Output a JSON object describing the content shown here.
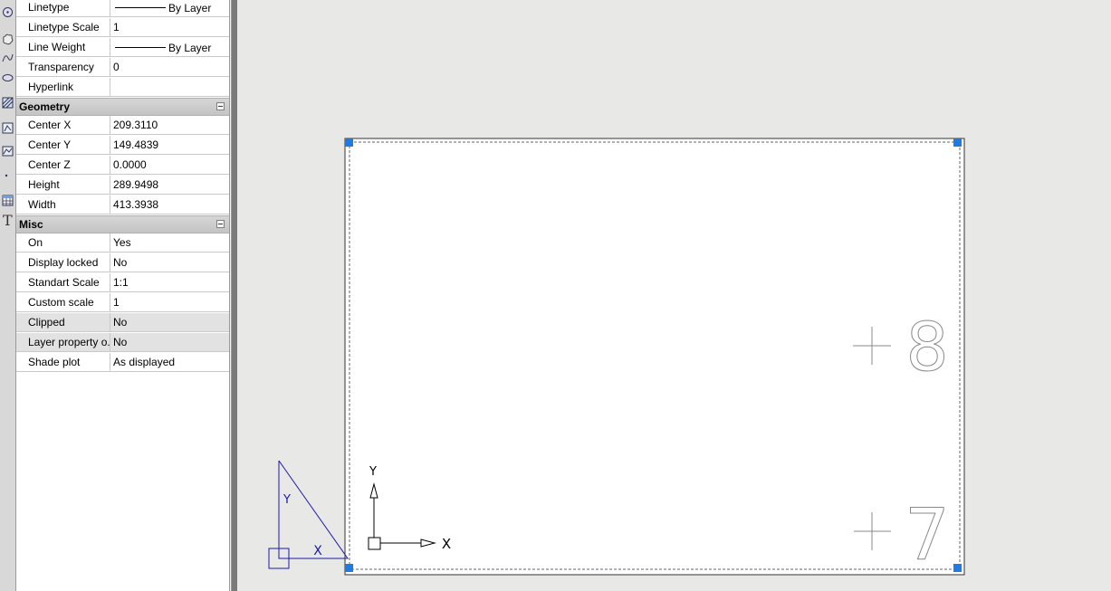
{
  "properties": {
    "general_rows": [
      {
        "name": "Linetype",
        "value": "By Layer",
        "line": true
      },
      {
        "name": "Linetype Scale",
        "value": "1"
      },
      {
        "name": "Line Weight",
        "value": "By Layer",
        "line": true
      },
      {
        "name": "Transparency",
        "value": "0"
      },
      {
        "name": "Hyperlink",
        "value": ""
      }
    ],
    "geometry": {
      "title": "Geometry",
      "rows": [
        {
          "name": "Center X",
          "value": "209.3110"
        },
        {
          "name": "Center Y",
          "value": "149.4839"
        },
        {
          "name": "Center Z",
          "value": "0.0000"
        },
        {
          "name": "Height",
          "value": "289.9498"
        },
        {
          "name": "Width",
          "value": "413.3938"
        }
      ]
    },
    "misc": {
      "title": "Misc",
      "rows": [
        {
          "name": "On",
          "value": "Yes"
        },
        {
          "name": "Display locked",
          "value": "No"
        },
        {
          "name": "Standart Scale",
          "value": "1:1"
        },
        {
          "name": "Custom scale",
          "value": "1"
        },
        {
          "name": "Clipped",
          "value": "No",
          "greyed": true
        },
        {
          "name": "Layer property o...",
          "value": "No",
          "greyed": true
        },
        {
          "name": "Shade plot",
          "value": "As displayed"
        }
      ]
    }
  },
  "viewport": {
    "grid_labels": [
      "8",
      "7"
    ],
    "ucs_labels": {
      "x": "X",
      "y": "Y"
    },
    "paper_ucs_labels": {
      "x": "X",
      "y": "Y"
    },
    "grip_color": "#1e7be6",
    "paper_ucs_color": "#1a1aa8"
  },
  "toolstrip": {
    "icons": [
      "circle-icon",
      "revcloud-icon",
      "spline-icon",
      "ellipse-icon",
      "hatch-icon",
      "gradient-icon",
      "region-icon",
      "point-icon",
      "table-icon",
      "text-icon"
    ]
  }
}
